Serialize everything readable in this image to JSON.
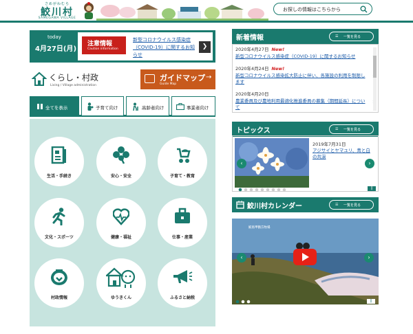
{
  "header": {
    "logo_sub": "さめがわむら",
    "logo_main": "鮫川村",
    "logo_en": "SAMEGAWA VILLAGE",
    "search_placeholder": "お探しの情報はこちらから"
  },
  "today": {
    "label": "today",
    "date": "4月27日(月)",
    "caution_title": "注意情報",
    "caution_en": "Caution information",
    "news": "新型コロナウイルス感染症（COVID-19）に関するお知らせ"
  },
  "kurashi": {
    "title": "くらし・村政",
    "en": "Living / Village administration"
  },
  "guide": {
    "title": "ガイドマップ",
    "en": "Guide Map"
  },
  "tabs": [
    {
      "label": "全てを表示"
    },
    {
      "label": "子育て向け"
    },
    {
      "label": "高齢者向け"
    },
    {
      "label": "事業者向け"
    }
  ],
  "categories": [
    {
      "label": "生活・手続き",
      "icon": "document-icon"
    },
    {
      "label": "安心・安全",
      "icon": "clover-icon"
    },
    {
      "label": "子育て・教育",
      "icon": "stroller-icon"
    },
    {
      "label": "文化・スポーツ",
      "icon": "runner-icon"
    },
    {
      "label": "健康・福祉",
      "icon": "heart-icon"
    },
    {
      "label": "仕事・産業",
      "icon": "briefcase-icon"
    },
    {
      "label": "村政情報",
      "icon": "village-emblem-icon"
    },
    {
      "label": "ゆうきくん",
      "icon": "house-icon"
    },
    {
      "label": "ふるさと納税",
      "icon": "megaphone-icon"
    }
  ],
  "news_section": {
    "title": "新着情報",
    "more": "一覧を見る"
  },
  "news": [
    {
      "date": "2020年4月27日",
      "new": "New!",
      "text": "新型コロナウイルス感染症（COVID-19）に関するお知らせ"
    },
    {
      "date": "2020年4月24日",
      "new": "New!",
      "text": "新型コロナウイルス感染拡大防止に伴い、各施設の利用を制限します"
    },
    {
      "date": "2020年4月20日",
      "new": "",
      "text": "農業委員及び農地利用最適化推進委員の募集（期間延長）について"
    }
  ],
  "topics_section": {
    "title": "トピックス",
    "more": "一覧を見る"
  },
  "topics": {
    "date": "2019年7月31日",
    "title": "アジサイとヤマユリ、青と白の共演"
  },
  "calendar_section": {
    "title": "鮫川村カレンダー",
    "more": "一覧を見る"
  },
  "video": {
    "caption": "鮫鳥甲鶴方牧場"
  },
  "colors": {
    "primary": "#1a7a6e",
    "panel": "#c7e4df",
    "caution": "#c8201b",
    "guide": "#c85a1c",
    "link": "#1a5aa8",
    "new": "#d2191a"
  }
}
